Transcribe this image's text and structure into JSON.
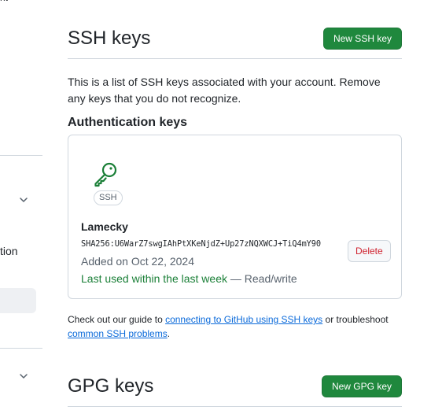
{
  "sidebar": {
    "top_fragment": "nt",
    "label_fragment": "tion"
  },
  "ssh_section": {
    "title": "SSH keys",
    "new_button": "New SSH key",
    "description": "This is a list of SSH keys associated with your account. Remove any keys that you do not recognize.",
    "subheading": "Authentication keys",
    "keys": [
      {
        "badge": "SSH",
        "title": "Lamecky",
        "fingerprint": "SHA256:U6WarZ7swgIAhPtXKeNjdZ+Up27zNQXWCJ+TiQ4mY90",
        "added": "Added on Oct 22, 2024",
        "last_used": "Last used within the last week",
        "access": " — Read/write",
        "delete_label": "Delete"
      }
    ],
    "guide": {
      "prefix": "Check out our guide to ",
      "link1": "connecting to GitHub using SSH keys",
      "middle": " or troubleshoot ",
      "link2": "common SSH problems",
      "suffix": "."
    }
  },
  "gpg_section": {
    "title": "GPG keys",
    "new_button": "New GPG key"
  },
  "colors": {
    "primary_button": "#1f883d",
    "key_icon": "#1a7f37",
    "danger": "#cf222e",
    "link": "#0969da"
  },
  "icons": {
    "key": "key-icon",
    "chevron": "chevron-down-icon"
  }
}
